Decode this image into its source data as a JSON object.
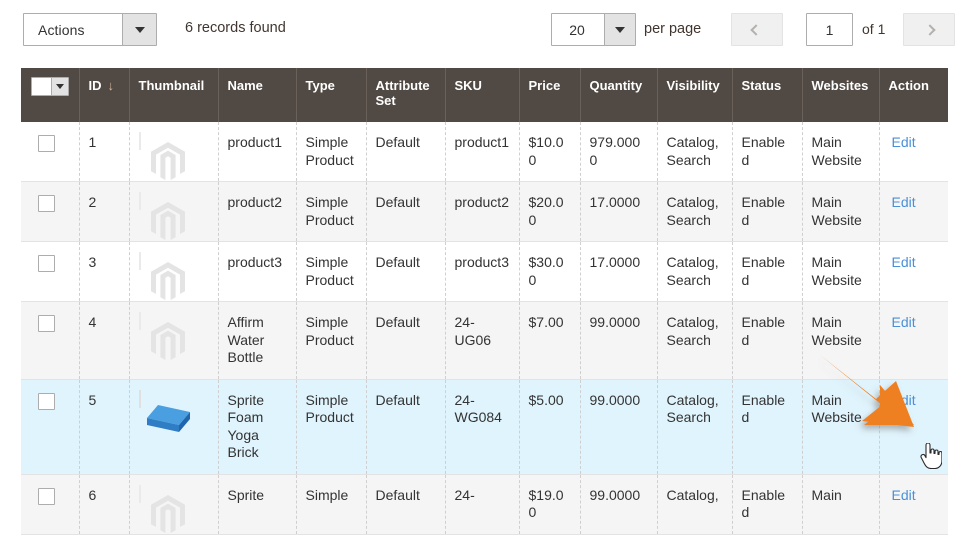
{
  "toolbar": {
    "actions_label": "Actions",
    "actions_caret_icon": "caret-down-icon",
    "records_found": "6 records found",
    "per_page_value": "20",
    "per_page_caret_icon": "caret-down-icon",
    "per_page_label": "per page",
    "prev_icon": "chevron-left-icon",
    "next_icon": "chevron-right-icon",
    "page_value": "1",
    "page_of": "of 1"
  },
  "grid": {
    "select_all_icon": "checkbox-dropdown-icon",
    "sort_indicator": "↓",
    "columns": [
      {
        "key": "select",
        "label": ""
      },
      {
        "key": "id",
        "label": "ID"
      },
      {
        "key": "thumbnail",
        "label": "Thumbnail"
      },
      {
        "key": "name",
        "label": "Name"
      },
      {
        "key": "type",
        "label": "Type"
      },
      {
        "key": "attr_set",
        "label": "Attribute Set"
      },
      {
        "key": "sku",
        "label": "SKU"
      },
      {
        "key": "price",
        "label": "Price"
      },
      {
        "key": "quantity",
        "label": "Quantity"
      },
      {
        "key": "visibility",
        "label": "Visibility"
      },
      {
        "key": "status",
        "label": "Status"
      },
      {
        "key": "websites",
        "label": "Websites"
      },
      {
        "key": "action",
        "label": "Action"
      }
    ],
    "rows": [
      {
        "id": "1",
        "thumb": "magento-placeholder-icon",
        "name": "product1",
        "type": "Simple Product",
        "attr_set": "Default",
        "sku": "product1",
        "price": "$10.00",
        "quantity": "979.0000",
        "visibility": "Catalog, Search",
        "status": "Enabled",
        "websites": "Main Website",
        "action": "Edit",
        "stripe": "odd"
      },
      {
        "id": "2",
        "thumb": "magento-placeholder-icon",
        "name": "product2",
        "type": "Simple Product",
        "attr_set": "Default",
        "sku": "product2",
        "price": "$20.00",
        "quantity": "17.0000",
        "visibility": "Catalog, Search",
        "status": "Enabled",
        "websites": "Main Website",
        "action": "Edit",
        "stripe": "even"
      },
      {
        "id": "3",
        "thumb": "magento-placeholder-icon",
        "name": "product3",
        "type": "Simple Product",
        "attr_set": "Default",
        "sku": "product3",
        "price": "$30.00",
        "quantity": "17.0000",
        "visibility": "Catalog, Search",
        "status": "Enabled",
        "websites": "Main Website",
        "action": "Edit",
        "stripe": "odd"
      },
      {
        "id": "4",
        "thumb": "magento-placeholder-icon",
        "name": "Affirm Water Bottle",
        "type": "Simple Product",
        "attr_set": "Default",
        "sku": "24-UG06",
        "price": "$7.00",
        "quantity": "99.0000",
        "visibility": "Catalog, Search",
        "status": "Enabled",
        "websites": "Main Website",
        "action": "Edit",
        "stripe": "even"
      },
      {
        "id": "5",
        "thumb": "yoga-brick-image",
        "name": "Sprite Foam Yoga Brick",
        "type": "Simple Product",
        "attr_set": "Default",
        "sku": "24-WG084",
        "price": "$5.00",
        "quantity": "99.0000",
        "visibility": "Catalog, Search",
        "status": "Enabled",
        "websites": "Main Website",
        "action": "Edit",
        "stripe": "hl"
      },
      {
        "id": "6",
        "thumb": "magento-placeholder-icon",
        "name": "Sprite",
        "type": "Simple",
        "attr_set": "Default",
        "sku": "24-",
        "price": "$19.00",
        "quantity": "99.0000",
        "visibility": "Catalog,",
        "status": "Enabled",
        "websites": "Main",
        "action": "Edit",
        "stripe": "even"
      }
    ]
  },
  "annotation": {
    "arrow_icon": "orange-arrow-pointer",
    "arrow_color": "#ef8022",
    "cursor_icon": "hand-pointer-cursor",
    "target": "Edit"
  },
  "colors": {
    "header_bg": "#514943",
    "row_highlight": "#e0f4fd",
    "row_stripe": "#f5f5f5",
    "link": "#4a90d9",
    "accent_orange": "#ef8022"
  }
}
